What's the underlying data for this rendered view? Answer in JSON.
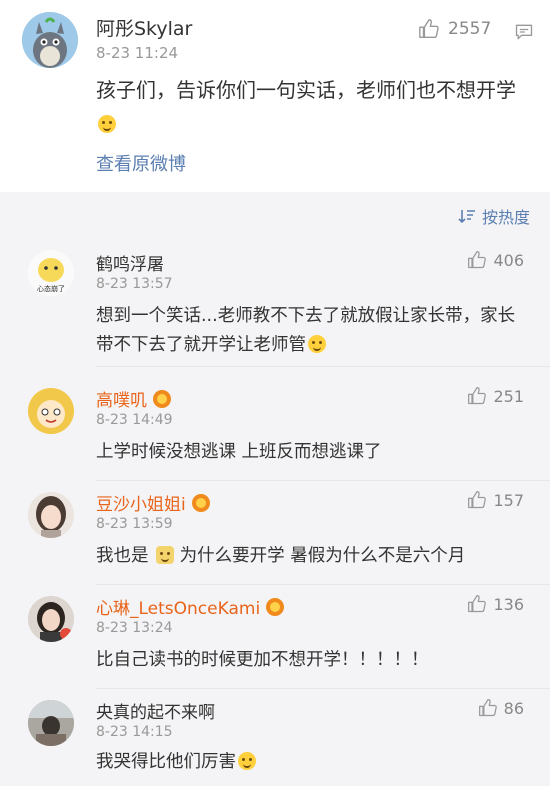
{
  "post": {
    "author": "阿彤Skylar",
    "time": "8-23 11:24",
    "likes": "2557",
    "text": "孩子们，告诉你们一句实话，老师们也不想开学",
    "view_original": "查看原微博"
  },
  "sort": {
    "label": "按热度"
  },
  "comments": [
    {
      "name": "鹤鸣浮屠",
      "time": "8-23 13:57",
      "likes": "406",
      "text": "想到一个笑话...老师教不下去了就放假让家长带，家长带不下去了就开学让老师管",
      "name_color": "#333333",
      "avatar_caption": "心态崩了"
    },
    {
      "name": "高噗叽",
      "time": "8-23 14:49",
      "likes": "251",
      "text": "上学时候没想逃课 上班反而想逃课了",
      "name_color": "#e8641b"
    },
    {
      "name": "豆沙小姐姐i",
      "time": "8-23 13:59",
      "likes": "157",
      "text_a": "我也是",
      "text_b": "为什么要开学 暑假为什么不是六个月",
      "name_color": "#e8641b"
    },
    {
      "name": "心琳_LetsOnceKami",
      "time": "8-23 13:24",
      "likes": "136",
      "text": "比自己读书的时候更加不想开学！！！！！",
      "name_color": "#e8641b"
    },
    {
      "name": "央真的起不来啊",
      "time": "8-23 14:15",
      "likes": "86",
      "text": "我哭得比他们厉害",
      "name_color": "#333333"
    }
  ],
  "colors": {
    "link": "#5b7fb0",
    "vip_name": "#e8641b",
    "meta": "#999999"
  }
}
